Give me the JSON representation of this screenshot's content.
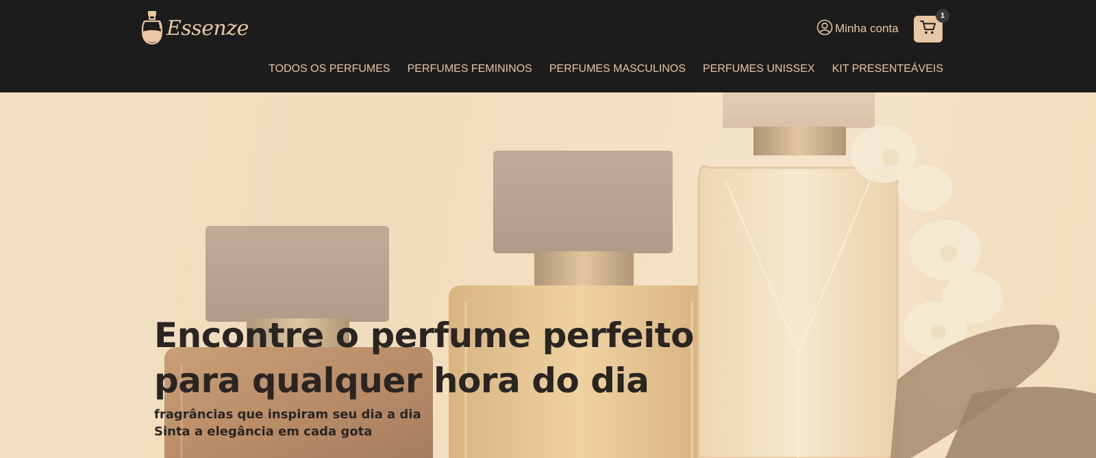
{
  "brand": {
    "name": "Essenze"
  },
  "header": {
    "account_label": "Minha conta",
    "cart_count": "1"
  },
  "nav": {
    "items": [
      {
        "label": "TODOS OS PERFUMES"
      },
      {
        "label": "PERFUMES FEMININOS"
      },
      {
        "label": "PERFUMES MASCULINOS"
      },
      {
        "label": "PERFUMES UNISSEX"
      },
      {
        "label": "KIT PRESENTEÁVEIS"
      }
    ]
  },
  "hero": {
    "title_line1": "Encontre o perfume perfeito",
    "title_line2": "para qualquer hora do dia",
    "subtitle_line1": "fragrâncias que inspiram seu dia a dia",
    "subtitle_line2": "Sinta a elegância em cada gota"
  },
  "colors": {
    "header_bg": "#1c1c1c",
    "accent": "#e8c7a4",
    "text_dark": "#2a2522"
  },
  "icons": {
    "logo": "perfume-bottle-icon",
    "account": "user-circle-icon",
    "cart": "shopping-cart-icon"
  }
}
